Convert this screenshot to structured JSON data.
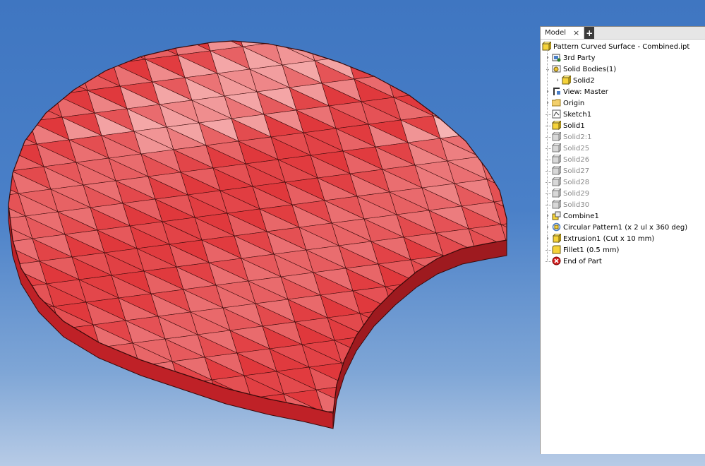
{
  "browser": {
    "tab_label": "Model",
    "tab_close": "×",
    "tab_add": "+",
    "items": [
      {
        "label": "Pattern Curved Surface - Combined.ipt",
        "icon": "part-file-icon",
        "level": 0,
        "twisty": "",
        "dim": false
      },
      {
        "label": "3rd Party",
        "icon": "third-party-icon",
        "level": 1,
        "twisty": "›",
        "dim": false
      },
      {
        "label": "Solid Bodies(1)",
        "icon": "solid-bodies-icon",
        "level": 1,
        "twisty": "⌄",
        "dim": false
      },
      {
        "label": "Solid2",
        "icon": "solid-body-icon",
        "level": 2,
        "twisty": "›",
        "dim": false
      },
      {
        "label": "View: Master",
        "icon": "view-icon",
        "level": 1,
        "twisty": "›",
        "dim": false
      },
      {
        "label": "Origin",
        "icon": "folder-icon",
        "level": 1,
        "twisty": "›",
        "dim": false
      },
      {
        "label": "Sketch1",
        "icon": "sketch-icon",
        "level": 1,
        "twisty": "",
        "dim": false
      },
      {
        "label": "Solid1",
        "icon": "solid-feature-icon",
        "level": 1,
        "twisty": "",
        "dim": false
      },
      {
        "label": "Solid2:1",
        "icon": "solid-feature-gray-icon",
        "level": 1,
        "twisty": "",
        "dim": true
      },
      {
        "label": "Solid25",
        "icon": "solid-feature-gray-icon",
        "level": 1,
        "twisty": "",
        "dim": true
      },
      {
        "label": "Solid26",
        "icon": "solid-feature-gray-icon",
        "level": 1,
        "twisty": "",
        "dim": true
      },
      {
        "label": "Solid27",
        "icon": "solid-feature-gray-icon",
        "level": 1,
        "twisty": "",
        "dim": true
      },
      {
        "label": "Solid28",
        "icon": "solid-feature-gray-icon",
        "level": 1,
        "twisty": "",
        "dim": true
      },
      {
        "label": "Solid29",
        "icon": "solid-feature-gray-icon",
        "level": 1,
        "twisty": "",
        "dim": true
      },
      {
        "label": "Solid30",
        "icon": "solid-feature-gray-icon",
        "level": 1,
        "twisty": "",
        "dim": true
      },
      {
        "label": "Combine1",
        "icon": "combine-icon",
        "level": 1,
        "twisty": "›",
        "dim": false
      },
      {
        "label": "Circular Pattern1 (x 2 ul x 360 deg)",
        "icon": "circular-pattern-icon",
        "level": 1,
        "twisty": "›",
        "dim": false
      },
      {
        "label": "Extrusion1 (Cut x 10 mm)",
        "icon": "extrusion-icon",
        "level": 1,
        "twisty": "›",
        "dim": false
      },
      {
        "label": "Fillet1 (0.5 mm)",
        "icon": "fillet-icon",
        "level": 1,
        "twisty": "",
        "dim": false
      },
      {
        "label": "End of Part",
        "icon": "end-of-part-icon",
        "level": 1,
        "twisty": "",
        "dim": false
      }
    ]
  },
  "viewport": {
    "background_top": "#3f76c1",
    "background_bottom": "#b7cbe6",
    "part_color": "#e0383c",
    "part_highlight": "#f6b3b3",
    "part_side": "#bf2127",
    "edge_color": "#3a0a0a"
  }
}
